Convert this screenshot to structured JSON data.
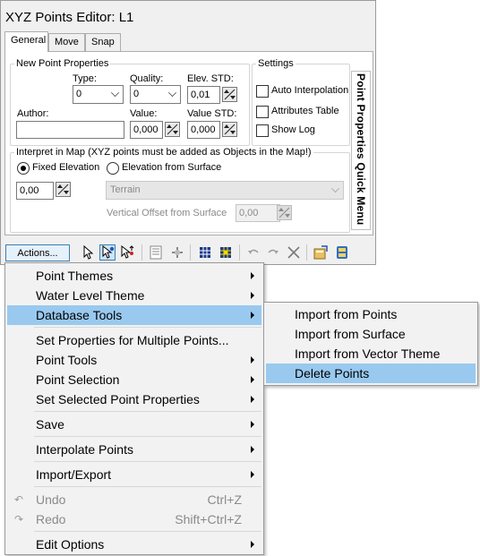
{
  "window": {
    "title": "XYZ Points Editor: L1",
    "tabs": [
      {
        "label": "General",
        "active": true
      },
      {
        "label": "Move",
        "active": false
      },
      {
        "label": "Snap",
        "active": false
      }
    ],
    "side_tab": "Point Properties Quick Menu"
  },
  "new_point": {
    "group_label": "New Point Properties",
    "type_label": "Type:",
    "type_value": "0",
    "quality_label": "Quality:",
    "quality_value": "0",
    "elev_std_label": "Elev. STD:",
    "elev_std_value": "0,01",
    "author_label": "Author:",
    "author_value": "",
    "value_label": "Value:",
    "value_value": "0,000",
    "value_std_label": "Value STD:",
    "value_std_value": "0,000"
  },
  "settings": {
    "group_label": "Settings",
    "auto_interpolation": {
      "label": "Auto Interpolation",
      "checked": false
    },
    "attributes_table": {
      "label": "Attributes Table",
      "checked": false
    },
    "show_log": {
      "label": "Show Log",
      "checked": false
    }
  },
  "interpret": {
    "group_label": "Interpret in Map (XYZ points must be added as Objects in the Map!)",
    "fixed_elevation": {
      "label": "Fixed Elevation",
      "selected": true
    },
    "elevation_from_surface": {
      "label": "Elevation from Surface",
      "selected": false
    },
    "elevation_value": "0,00",
    "surface_value": "Terrain",
    "vertical_offset_label": "Vertical Offset from Surface",
    "vertical_offset_value": "0,00"
  },
  "toolbar": {
    "actions_label": "Actions...",
    "icons": [
      "arrow-select-icon",
      "add-point-icon",
      "move-point-icon",
      "list-icon",
      "split-icon",
      "grid-icon",
      "grid-yellow-icon",
      "undo-icon",
      "redo-icon",
      "delete-icon",
      "properties-icon",
      "save-db-icon"
    ]
  },
  "menu": {
    "items": [
      {
        "label": "Point Themes",
        "submenu": true
      },
      {
        "label": "Water Level Theme",
        "submenu": true
      },
      {
        "label": "Database Tools",
        "submenu": true,
        "highlighted": true
      },
      {
        "label": "Set Properties for Multiple Points...",
        "submenu": false
      },
      {
        "label": "Point Tools",
        "submenu": true
      },
      {
        "label": "Point Selection",
        "submenu": true
      },
      {
        "label": "Set Selected Point Properties",
        "submenu": true
      },
      {
        "label": "Save",
        "submenu": true
      },
      {
        "label": "Interpolate Points",
        "submenu": true
      },
      {
        "label": "Import/Export",
        "submenu": true
      },
      {
        "label": "Undo",
        "shortcut": "Ctrl+Z",
        "disabled": true
      },
      {
        "label": "Redo",
        "shortcut": "Shift+Ctrl+Z",
        "disabled": true
      },
      {
        "label": "Edit Options",
        "submenu": true
      }
    ]
  },
  "submenu": {
    "items": [
      {
        "label": "Import from Points"
      },
      {
        "label": "Import from Surface"
      },
      {
        "label": "Import from Vector Theme"
      },
      {
        "label": "Delete Points",
        "highlighted": true
      }
    ]
  },
  "colors": {
    "highlight": "#99c9ef",
    "menu_bg": "#f2f2f2",
    "window_bg": "#f0f0f0"
  }
}
